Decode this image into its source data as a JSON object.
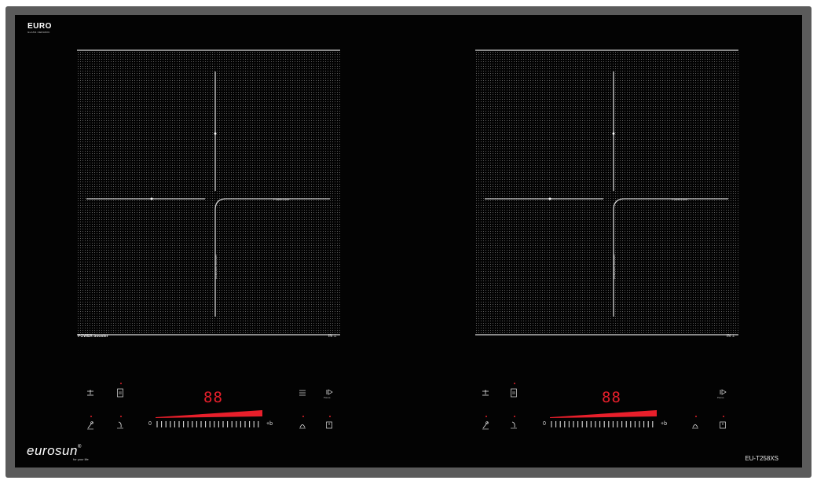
{
  "brand": {
    "title": "EURO",
    "subtitle": "GLASS CERAMIC"
  },
  "logo": {
    "name": "eurosun",
    "registered": "®",
    "tagline": "for your life"
  },
  "model": "EU-T258XS",
  "zones": {
    "left": {
      "power_label": "POWER booster",
      "in_label": "IN",
      "vertical_text": "Induction Booster",
      "horizontal_text": "PowerZone"
    },
    "right": {
      "in_label": "IN",
      "vertical_text": "Induction Booster",
      "horizontal_text": "PowerZone"
    }
  },
  "controls": {
    "left": {
      "display": "88",
      "slider_min": "0",
      "slider_max": "+b",
      "timer_dot_label": "on",
      "pause_label": "Pause",
      "keep_warm_label": "WARM"
    },
    "right": {
      "display": "88",
      "slider_min": "0",
      "slider_max": "+b",
      "timer_dot_label": "on",
      "pause_label": "Pause"
    }
  },
  "colors": {
    "frame": "#5b5b5b",
    "glass": "#030303",
    "led": "#e81f2b"
  },
  "icons": [
    "bridge-zone-icon",
    "timer-icon",
    "lock-icon",
    "sensor-cook-icon",
    "menu-icon",
    "pause-icon",
    "keep-warm-icon",
    "power-icon"
  ]
}
